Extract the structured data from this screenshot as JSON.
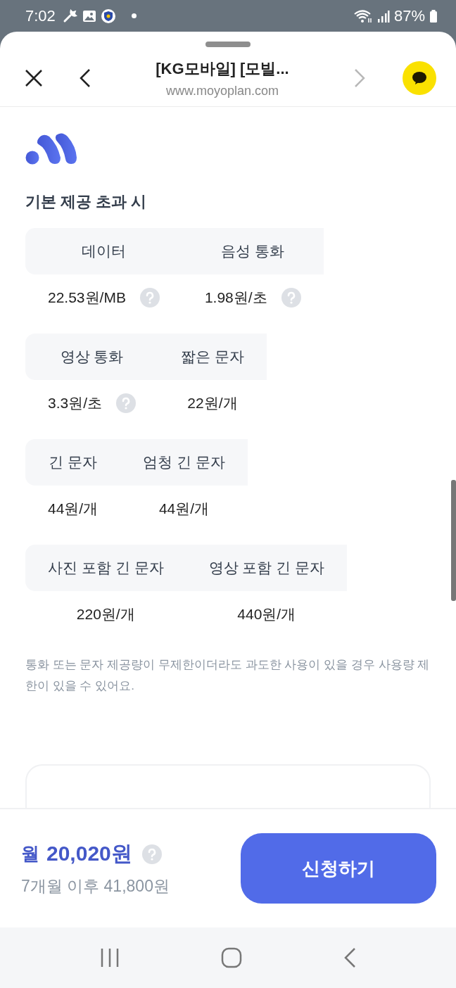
{
  "status_bar": {
    "time": "7:02",
    "battery": "87%"
  },
  "header": {
    "title": "[KG모바일] [모빌...",
    "url": "www.moyoplan.com",
    "forward_disabled": true
  },
  "section": {
    "title": "기본 제공 초과 시",
    "groups": [
      {
        "items": [
          {
            "label": "데이터",
            "value": "22.53원/MB",
            "help": true
          },
          {
            "label": "음성 통화",
            "value": "1.98원/초",
            "help": true
          }
        ]
      },
      {
        "items": [
          {
            "label": "영상 통화",
            "value": "3.3원/초",
            "help": true
          },
          {
            "label": "짧은 문자",
            "value": "22원/개",
            "help": false
          }
        ]
      },
      {
        "items": [
          {
            "label": "긴 문자",
            "value": "44원/개",
            "help": false
          },
          {
            "label": "엄청 긴 문자",
            "value": "44원/개",
            "help": false
          }
        ]
      },
      {
        "items": [
          {
            "label": "사진 포함 긴 문자",
            "value": "220원/개",
            "help": false
          },
          {
            "label": "영상 포함 긴 문자",
            "value": "440원/개",
            "help": false
          }
        ]
      }
    ],
    "note": "통화 또는 문자 제공량이 무제한이더라도 과도한 사용이 있을 경우 사용량 제한이 있을 수 있어요."
  },
  "footer": {
    "price_prefix": "월",
    "price": "20,020원",
    "after_price": "7개월 이후 41,800원",
    "apply_button": "신청하기"
  }
}
